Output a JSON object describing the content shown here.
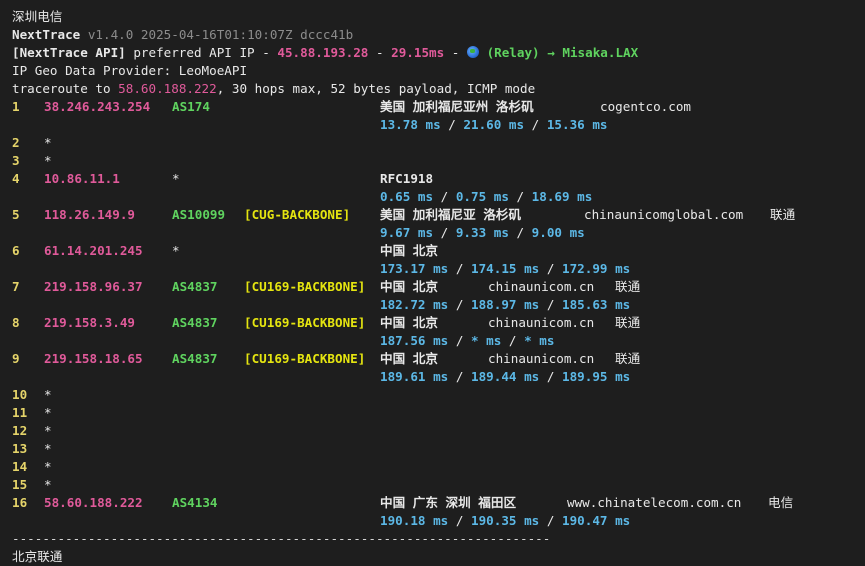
{
  "separator": "-----------------------------------------------------------------------",
  "header": {
    "location": "深圳电信",
    "app_name": "NextTrace",
    "version": "v1.4.0 2025-04-16T01:10:07Z dccc41b",
    "api_tag": "[NextTrace API]",
    "api_text": " preferred API IP - ",
    "api_ip": "45.88.193.28",
    "api_dash": " - ",
    "api_latency": "29.15ms",
    "api_dash2": " - ",
    "api_relay": "(Relay) → Misaka.LAX",
    "geo_provider": "IP Geo Data Provider: LeoMoeAPI",
    "trace_prefix": "traceroute to ",
    "trace_target": "58.60.188.222",
    "trace_suffix": ", 30 hops max, 52 bytes payload, ICMP mode"
  },
  "hops": [
    {
      "no": "1",
      "ip": "38.246.243.254",
      "as": "AS174",
      "tag": "",
      "geo": "美国 加利福尼亚州 洛杉矶",
      "host": "cogentco.com",
      "isp": "",
      "rtt": [
        "13.78 ms",
        "21.60 ms",
        "15.36 ms"
      ]
    },
    {
      "no": "2",
      "star": "*"
    },
    {
      "no": "3",
      "star": "*"
    },
    {
      "no": "4",
      "ip": "10.86.11.1",
      "as": "*",
      "tag": "",
      "geo": "RFC1918",
      "host": "",
      "isp": "",
      "rtt": [
        "0.65 ms",
        "0.75 ms",
        "18.69 ms"
      ]
    },
    {
      "no": "5",
      "ip": "118.26.149.9",
      "as": "AS10099",
      "tag": "[CUG-BACKBONE]",
      "geo": "美国 加利福尼亚 洛杉矶",
      "host": "chinaunicomglobal.com",
      "isp": "联通",
      "rtt": [
        "9.67 ms",
        "9.33 ms",
        "9.00 ms"
      ]
    },
    {
      "no": "6",
      "ip": "61.14.201.245",
      "as": "*",
      "tag": "",
      "geo": "中国 北京",
      "host": "",
      "isp": "",
      "rtt": [
        "173.17 ms",
        "174.15 ms",
        "172.99 ms"
      ]
    },
    {
      "no": "7",
      "ip": "219.158.96.37",
      "as": "AS4837",
      "tag": "[CU169-BACKBONE]",
      "geo": "中国 北京",
      "host": "chinaunicom.cn",
      "isp": "联通",
      "rtt": [
        "182.72 ms",
        "188.97 ms",
        "185.63 ms"
      ]
    },
    {
      "no": "8",
      "ip": "219.158.3.49",
      "as": "AS4837",
      "tag": "[CU169-BACKBONE]",
      "geo": "中国 北京",
      "host": "chinaunicom.cn",
      "isp": "联通",
      "rtt": [
        "187.56 ms",
        "* ms",
        "* ms"
      ]
    },
    {
      "no": "9",
      "ip": "219.158.18.65",
      "as": "AS4837",
      "tag": "[CU169-BACKBONE]",
      "geo": "中国 北京",
      "host": "chinaunicom.cn",
      "isp": "联通",
      "rtt": [
        "189.61 ms",
        "189.44 ms",
        "189.95 ms"
      ]
    },
    {
      "no": "10",
      "star": "*"
    },
    {
      "no": "11",
      "star": "*"
    },
    {
      "no": "12",
      "star": "*"
    },
    {
      "no": "13",
      "star": "*"
    },
    {
      "no": "14",
      "star": "*"
    },
    {
      "no": "15",
      "star": "*"
    },
    {
      "no": "16",
      "ip": "58.60.188.222",
      "as": "AS4134",
      "tag": "",
      "geo": "中国 广东 深圳 福田区",
      "host": "www.chinatelecom.com.cn",
      "isp": "电信",
      "rtt": [
        "190.18 ms",
        "190.35 ms",
        "190.47 ms"
      ]
    }
  ],
  "footer": {
    "next_location": "北京联通"
  }
}
